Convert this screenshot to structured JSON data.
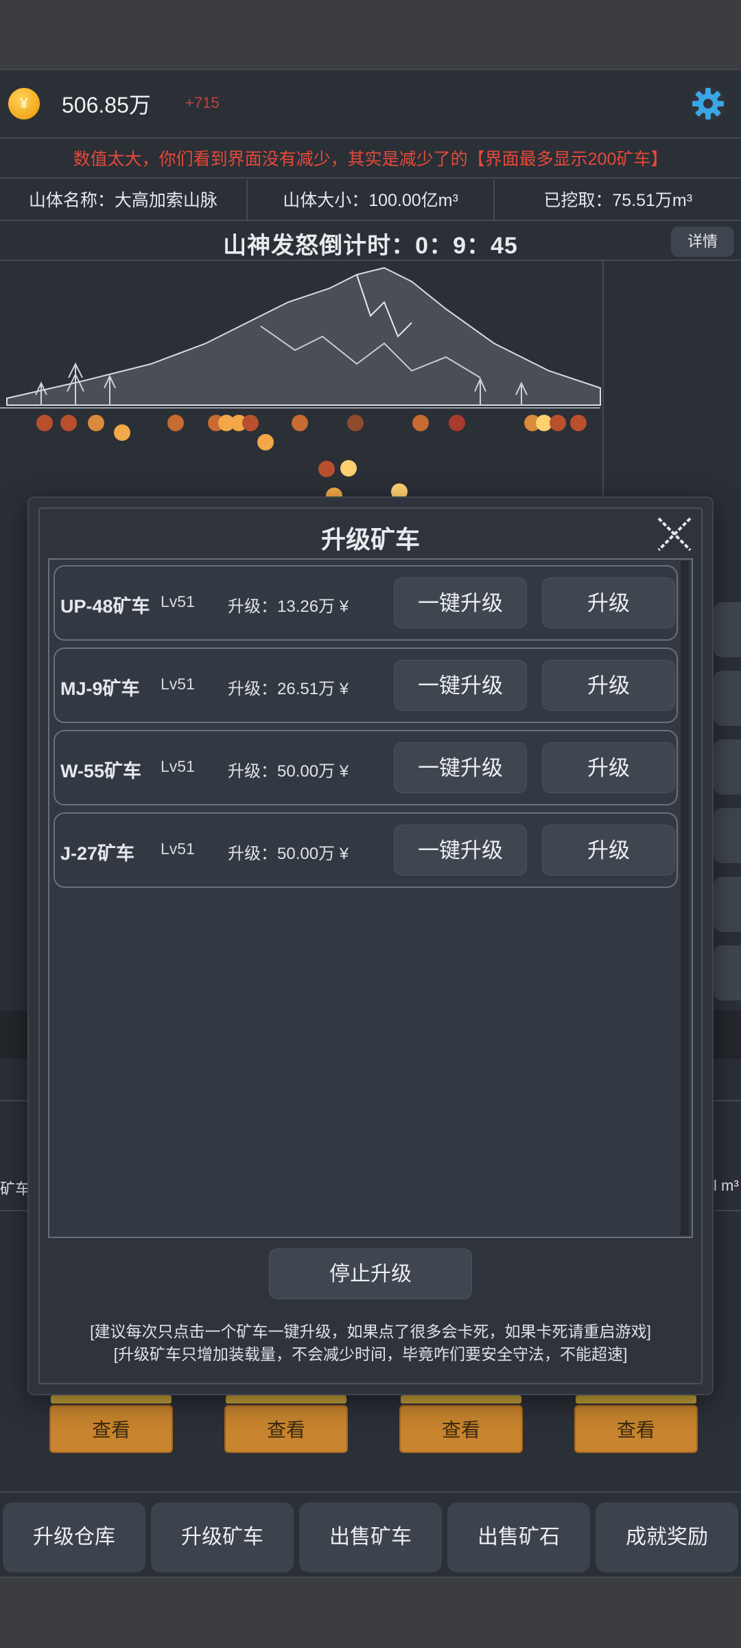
{
  "topbar": {
    "coin_symbol": "¥",
    "coin_amount": "506.85万",
    "coin_delta": "+715"
  },
  "notice": "数值太大，你们看到界面没有减少，其实是减少了的【界面最多显示200矿车】",
  "stats": {
    "mountain_name": "山体名称：大高加索山脉",
    "mountain_size": "山体大小：100.00亿m³",
    "mined": "已挖取：75.51万m³"
  },
  "countdown": "山神发怒倒计时：0：9：45",
  "details_label": "详情",
  "edge_texts": {
    "left": "矿车",
    "right": "l m³"
  },
  "view_buttons": [
    "查看",
    "查看",
    "查看",
    "查看"
  ],
  "nav": [
    "升级仓库",
    "升级矿车",
    "出售矿车",
    "出售矿石",
    "成就奖励"
  ],
  "modal": {
    "title": "升级矿车",
    "carts": [
      {
        "name": "UP-48矿车",
        "level": "Lv51",
        "cost": "升级：13.26万 ¥",
        "one_click": "一键升级",
        "upgrade": "升级"
      },
      {
        "name": "MJ-9矿车",
        "level": "Lv51",
        "cost": "升级：26.51万 ¥",
        "one_click": "一键升级",
        "upgrade": "升级"
      },
      {
        "name": "W-55矿车",
        "level": "Lv51",
        "cost": "升级：50.00万 ¥",
        "one_click": "一键升级",
        "upgrade": "升级"
      },
      {
        "name": "J-27矿车",
        "level": "Lv51",
        "cost": "升级：50.00万 ¥",
        "one_click": "一键升级",
        "upgrade": "升级"
      }
    ],
    "stop_label": "停止升级",
    "tip1": "[建议每次只点击一个矿车一键升级，如果点了很多会卡死，如果卡死请重启游戏]",
    "tip2": "[升级矿车只增加装载量，不会减少时间，毕竟咋们要安全守法，不能超速]"
  },
  "colors": {
    "accent_orange": "#c8842e",
    "notice_red": "#e34a3a",
    "gear_blue": "#3aa6e6"
  }
}
